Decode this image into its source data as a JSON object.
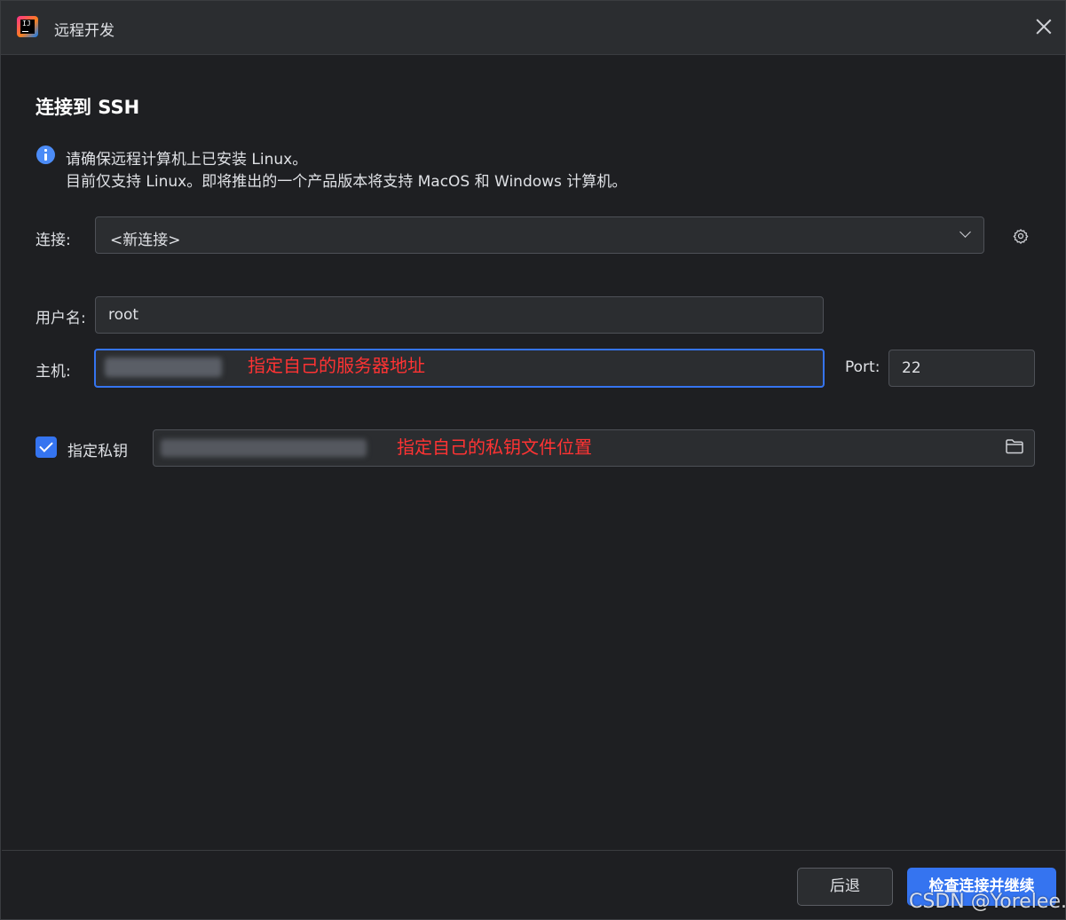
{
  "window": {
    "title": "远程开发",
    "close_icon": "close-icon",
    "app_icon": "intellij-logo-icon"
  },
  "heading": "连接到 SSH",
  "info": {
    "icon": "info-icon",
    "line1": "请确保远程计算机上已安装 Linux。",
    "line2": "目前仅支持 Linux。即将推出的一个产品版本将支持 MacOS 和 Windows 计算机。"
  },
  "connection": {
    "label": "连接:",
    "selected": "<新连接>",
    "settings_icon": "gear-icon"
  },
  "username": {
    "label": "用户名:",
    "value": "root"
  },
  "host": {
    "label": "主机:",
    "value": "",
    "annotation": "指定自己的服务器地址"
  },
  "port": {
    "label": "Port:",
    "value": "22"
  },
  "private_key": {
    "label": "指定私钥",
    "checked": true,
    "value": "",
    "annotation": "指定自己的私钥文件位置",
    "browse_icon": "folder-icon"
  },
  "buttons": {
    "back": "后退",
    "continue": "检查连接并继续"
  },
  "watermark": "CSDN @Yorelee.",
  "colors": {
    "accent": "#3574f0",
    "background": "#1e1f22",
    "field": "#2b2d30",
    "annotation": "#ff3333"
  }
}
